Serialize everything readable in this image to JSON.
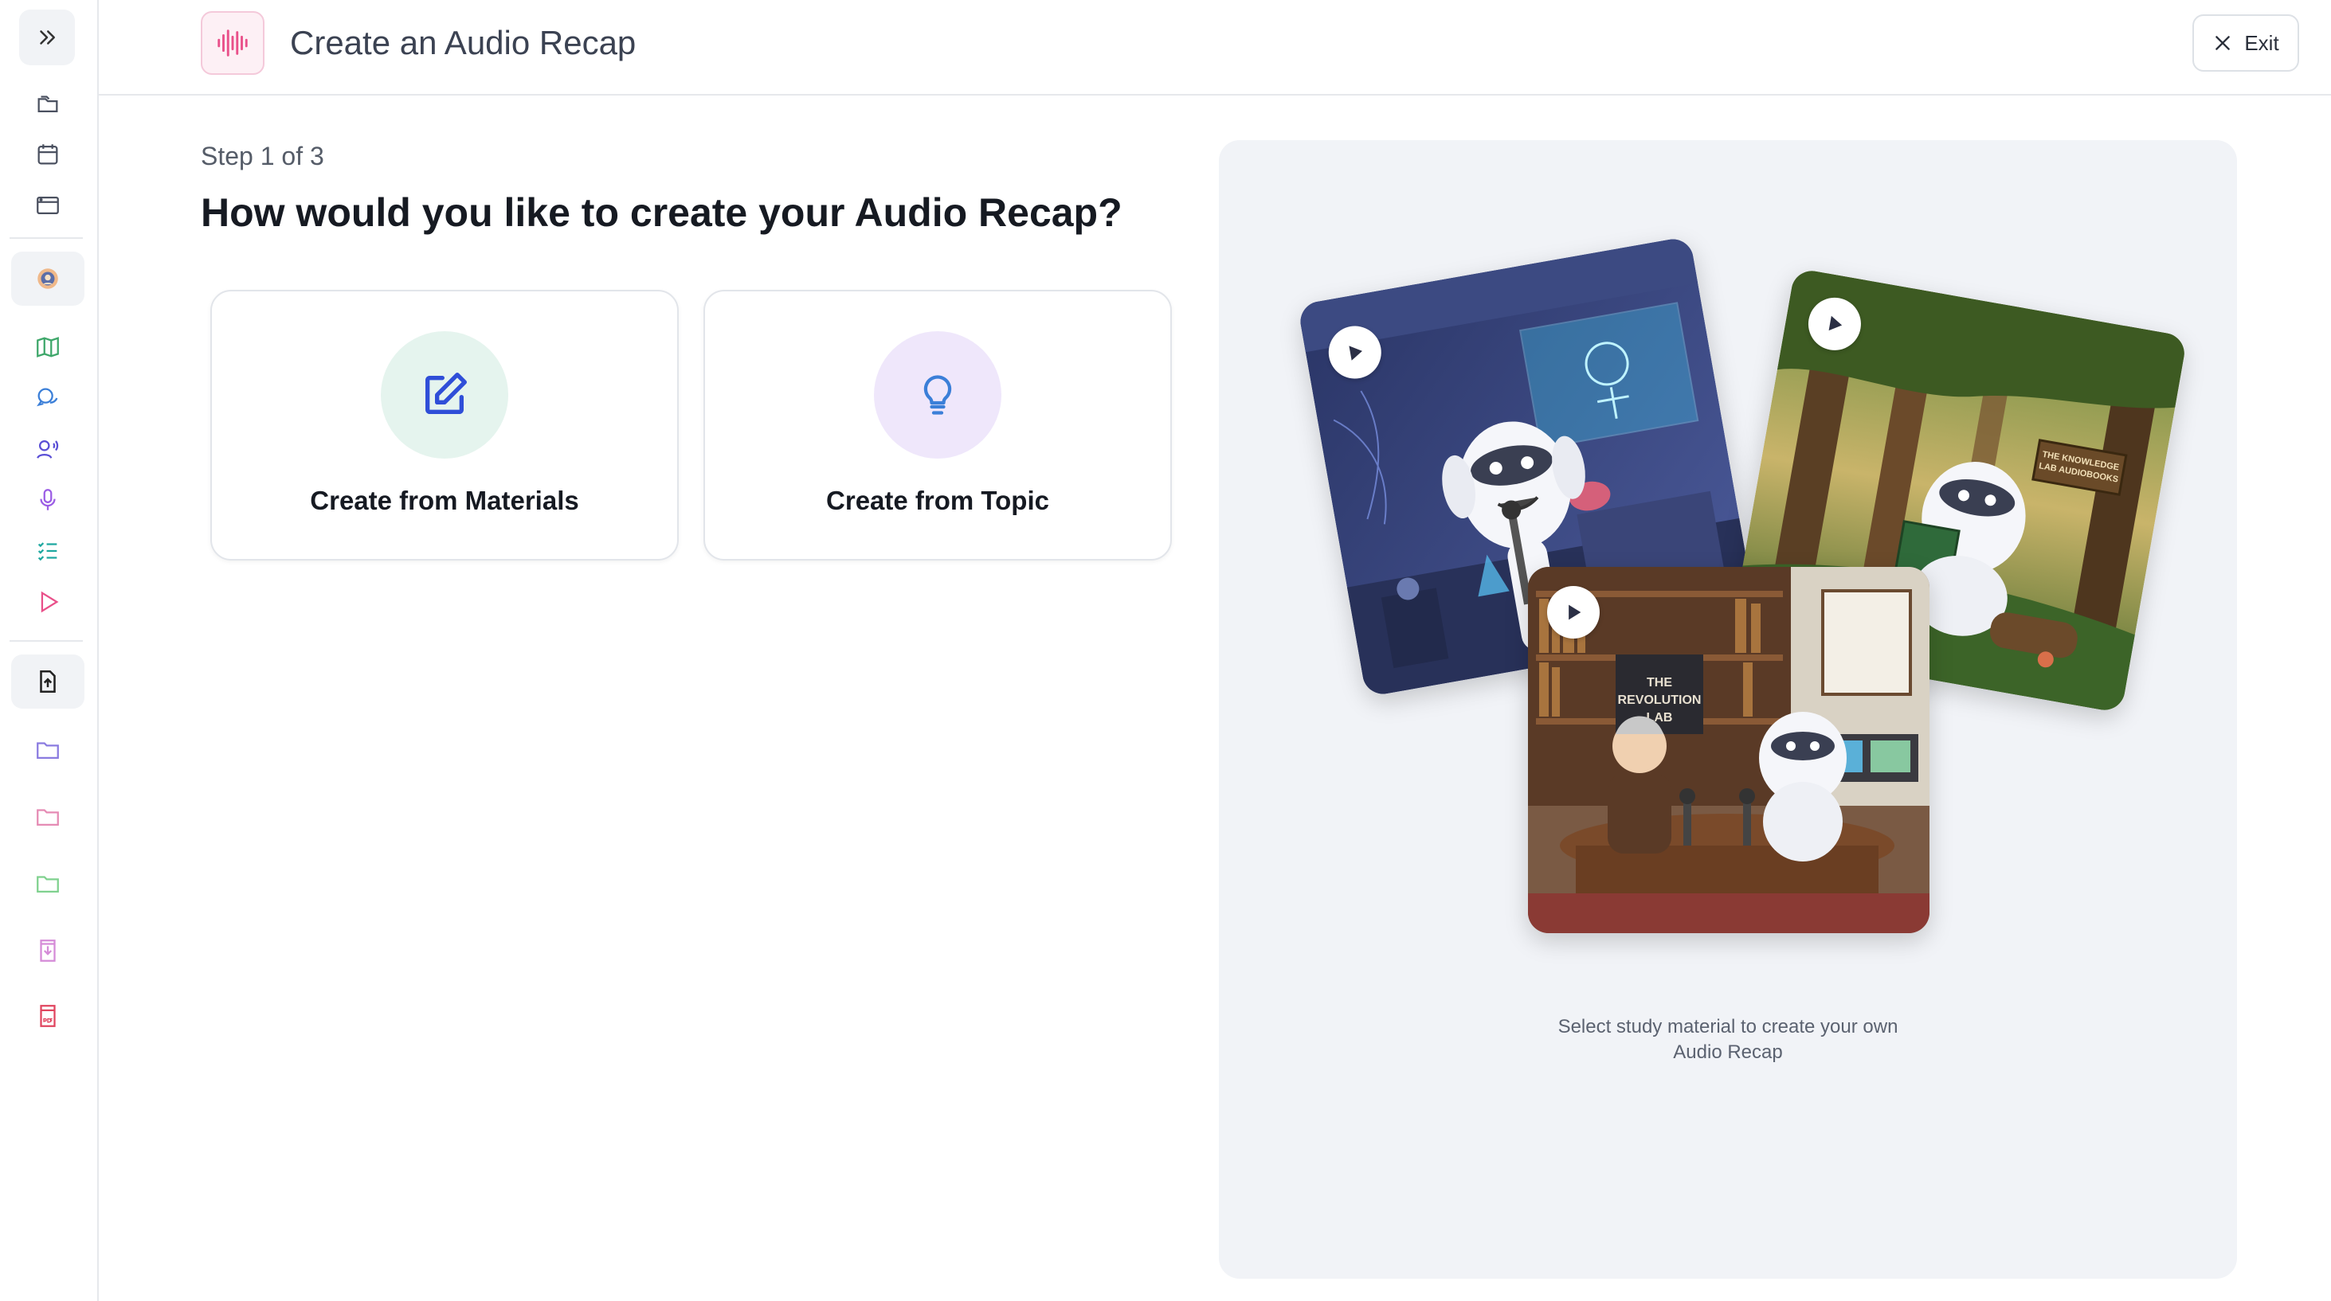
{
  "header": {
    "title": "Create an Audio Recap",
    "exit_label": "Exit"
  },
  "main": {
    "step": "Step 1 of 3",
    "question": "How would you like to create your Audio Recap?",
    "options": [
      {
        "label": "Create from Materials",
        "icon": "edit-icon",
        "bg": "#e5f4ee"
      },
      {
        "label": "Create from Topic",
        "icon": "lightbulb-icon",
        "bg": "#efe7fb"
      }
    ]
  },
  "preview": {
    "caption_line1": "Select study material to create your own",
    "caption_line2": "Audio Recap",
    "cards": [
      {
        "scene": "lab",
        "sign_text": ""
      },
      {
        "scene": "forest",
        "sign_text": "THE KNOWLEDGE LAB AUDIOBOOKS"
      },
      {
        "scene": "library",
        "sign_text": "THE REVOLUTION LAB"
      }
    ]
  },
  "sidebar": {
    "icons": [
      "expand-icon",
      "folders-icon",
      "calendar-icon",
      "browser-icon",
      "avatar-icon",
      "map-icon",
      "chat-icon",
      "voice-icon",
      "microphone-icon",
      "checklist-icon",
      "play-icon",
      "upload-file-icon",
      "folder-purple-icon",
      "folder-pink-icon",
      "folder-green-icon",
      "download-file-icon",
      "pdf-icon"
    ]
  },
  "colors": {
    "accent_pink": "#e9508a",
    "accent_blue": "#2f4ed8",
    "border": "#e2e5ea"
  }
}
